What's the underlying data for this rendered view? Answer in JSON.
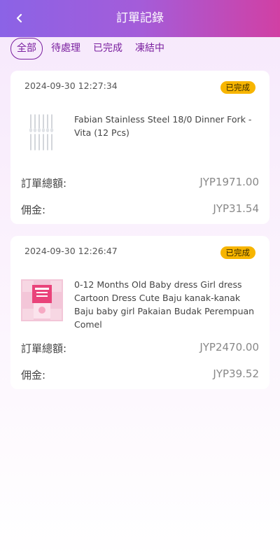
{
  "header": {
    "title": "訂單記錄",
    "back_icon": "chevron-left-icon"
  },
  "tabs": [
    {
      "label": "全部",
      "active": true
    },
    {
      "label": "待處理",
      "active": false
    },
    {
      "label": "已完成",
      "active": false
    },
    {
      "label": "凍結中",
      "active": false
    }
  ],
  "orders": [
    {
      "date": "2024-09-30 12:27:34",
      "status": "已完成",
      "product_name": "Fabian Stainless Steel 18/0 Dinner Fork - Vita (12 Pcs)",
      "total_label": "訂單總額:",
      "total_value": "JYP1971.00",
      "commission_label": "佣金:",
      "commission_value": "JYP31.54"
    },
    {
      "date": "2024-09-30 12:26:47",
      "status": "已完成",
      "product_name": "0-12 Months Old Baby dress Girl dress Cartoon Dress Cute Baju kanak-kanak Baju baby girl Pakaian Budak Perempuan Comel",
      "total_label": "訂單總額:",
      "total_value": "JYP2470.00",
      "commission_label": "佣金:",
      "commission_value": "JYP39.52"
    }
  ],
  "colors": {
    "header_start": "#8b63e6",
    "header_end": "#d140a4",
    "tab_text": "#7a1f9f",
    "badge_bg": "#f7b500"
  }
}
